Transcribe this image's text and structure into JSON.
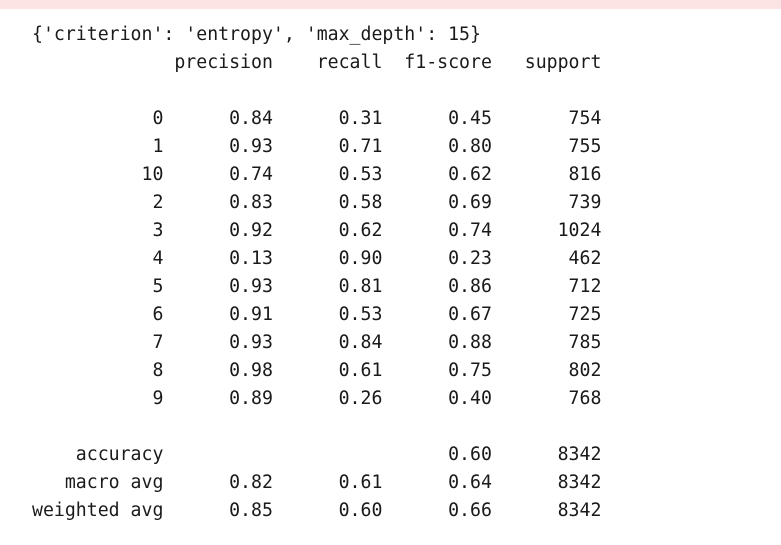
{
  "cell_output": {
    "params_line": "{'criterion': 'entropy', 'max_depth': 15}",
    "report": {
      "headers": [
        "precision",
        "recall",
        "f1-score",
        "support"
      ],
      "classes": [
        {
          "label": "0",
          "precision": "0.84",
          "recall": "0.31",
          "f1": "0.45",
          "support": "754"
        },
        {
          "label": "1",
          "precision": "0.93",
          "recall": "0.71",
          "f1": "0.80",
          "support": "755"
        },
        {
          "label": "10",
          "precision": "0.74",
          "recall": "0.53",
          "f1": "0.62",
          "support": "816"
        },
        {
          "label": "2",
          "precision": "0.83",
          "recall": "0.58",
          "f1": "0.69",
          "support": "739"
        },
        {
          "label": "3",
          "precision": "0.92",
          "recall": "0.62",
          "f1": "0.74",
          "support": "1024"
        },
        {
          "label": "4",
          "precision": "0.13",
          "recall": "0.90",
          "f1": "0.23",
          "support": "462"
        },
        {
          "label": "5",
          "precision": "0.93",
          "recall": "0.81",
          "f1": "0.86",
          "support": "712"
        },
        {
          "label": "6",
          "precision": "0.91",
          "recall": "0.53",
          "f1": "0.67",
          "support": "725"
        },
        {
          "label": "7",
          "precision": "0.93",
          "recall": "0.84",
          "f1": "0.88",
          "support": "785"
        },
        {
          "label": "8",
          "precision": "0.98",
          "recall": "0.61",
          "f1": "0.75",
          "support": "802"
        },
        {
          "label": "9",
          "precision": "0.89",
          "recall": "0.26",
          "f1": "0.40",
          "support": "768"
        }
      ],
      "summary": [
        {
          "label": "accuracy",
          "precision": "",
          "recall": "",
          "f1": "0.60",
          "support": "8342"
        },
        {
          "label": "macro avg",
          "precision": "0.82",
          "recall": "0.61",
          "f1": "0.64",
          "support": "8342"
        },
        {
          "label": "weighted avg",
          "precision": "0.85",
          "recall": "0.60",
          "f1": "0.66",
          "support": "8342"
        }
      ]
    }
  },
  "colors": {
    "top_bar": "#fde4e4",
    "text": "#1a1a1a",
    "background": "#ffffff"
  }
}
